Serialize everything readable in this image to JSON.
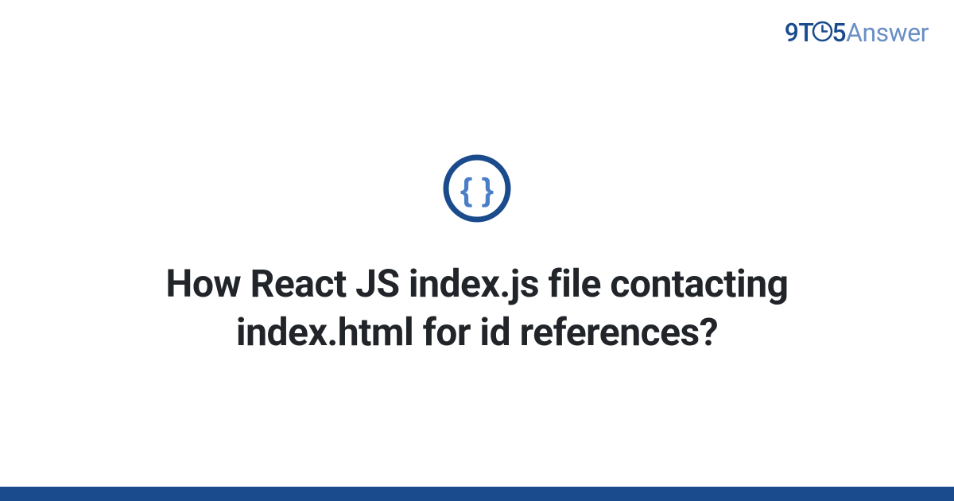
{
  "brand": {
    "part1": "9T",
    "part2": "5",
    "part3": "Answer"
  },
  "question": {
    "title": "How React JS index.js file contacting index.html for id references?"
  },
  "colors": {
    "brand_primary": "#1a4b8c",
    "brand_secondary": "#6a8fc7",
    "icon_inner": "#4a7ec7",
    "text": "#212529"
  }
}
